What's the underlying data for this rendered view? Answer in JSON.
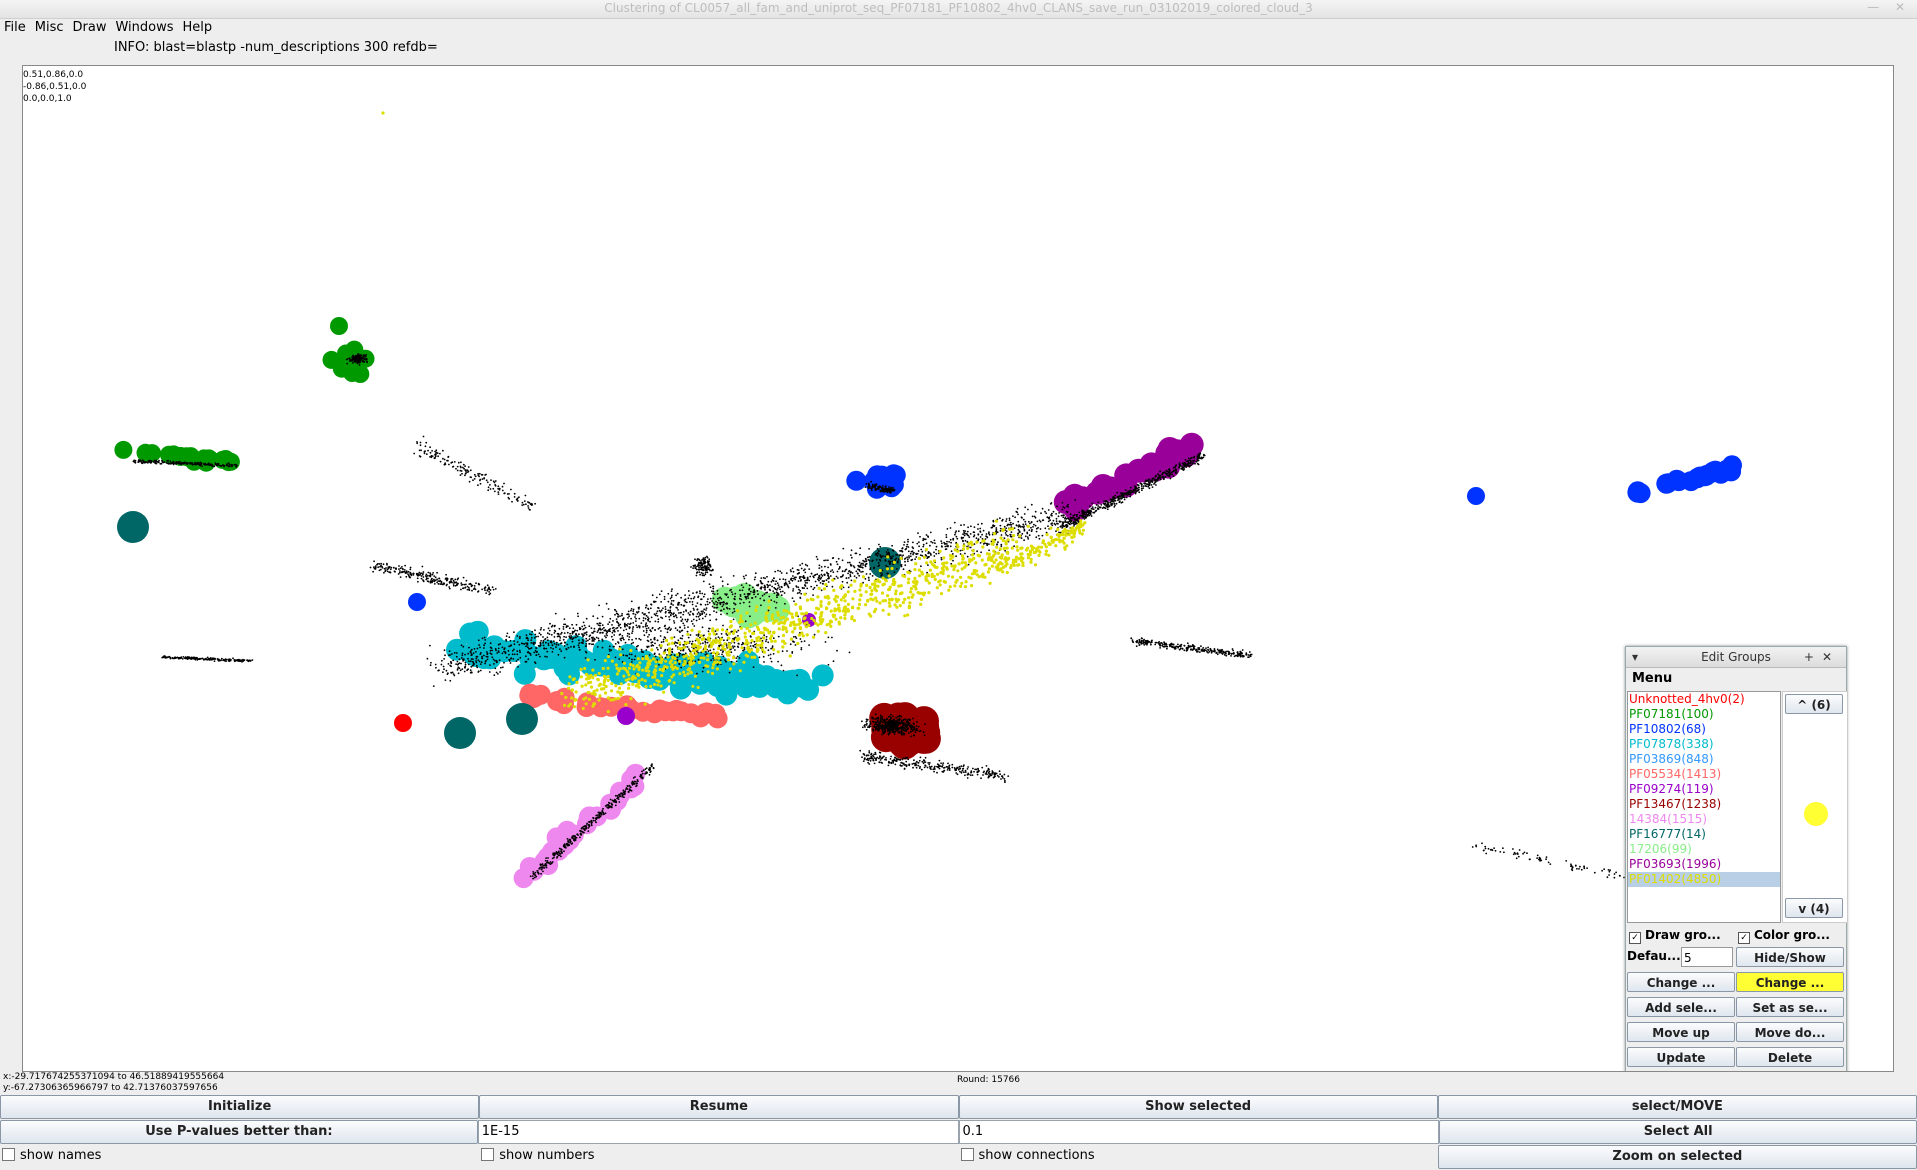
{
  "window": {
    "title": "Clustering of CL0057_all_fam_and_uniprot_seq_PF07181_PF10802_4hv0_CLANS_save_run_03102019_colored_cloud_3"
  },
  "menu": [
    "File",
    "Misc",
    "Draw",
    "Windows",
    "Help"
  ],
  "info_text": "INFO: blast=blastp -num_descriptions 300 refdb=",
  "rotation_matrix": [
    "0.51,0.86,0.0",
    "-0.86,0.51,0.0",
    "0.0,0.0,1.0"
  ],
  "coords": {
    "x_range": "x:-29.717674255371094 to 46.51889419555664",
    "y_range": "y:-67.27306365966797 to 42.71376037597656"
  },
  "round_text": "Round: 15766",
  "controls": {
    "row1": [
      "Initialize",
      "Resume",
      "Show selected",
      "select/MOVE"
    ],
    "pvalue_label": "Use P-values better than:",
    "pvalue_value": "1E-15",
    "second_value": "0.1",
    "select_all": "Select All",
    "show_names": "show names",
    "show_numbers": "show numbers",
    "show_connections": "show connections",
    "zoom_selected": "Zoom on selected"
  },
  "edit_groups": {
    "title": "Edit Groups",
    "menu_label": "Menu",
    "groups": [
      {
        "label": "Unknotted_4hv0(2)",
        "color": "#ff0000"
      },
      {
        "label": "PF07181(100)",
        "color": "#009900"
      },
      {
        "label": "PF10802(68)",
        "color": "#0033ff"
      },
      {
        "label": "PF07878(338)",
        "color": "#00bbcc"
      },
      {
        "label": "PF03869(848)",
        "color": "#3399ff"
      },
      {
        "label": "PF05534(1413)",
        "color": "#ff6666"
      },
      {
        "label": "PF09274(119)",
        "color": "#9900cc"
      },
      {
        "label": "PF13467(1238)",
        "color": "#990000"
      },
      {
        "label": "14384(1515)",
        "color": "#ee88ee"
      },
      {
        "label": "PF16777(14)",
        "color": "#006666"
      },
      {
        "label": "17206(99)",
        "color": "#88ee88"
      },
      {
        "label": "PF03693(1996)",
        "color": "#990099"
      },
      {
        "label": "PF01402(4850)",
        "color": "#dddd00"
      }
    ],
    "up_btn": "^ (6)",
    "down_btn": "v (4)",
    "draw_groups": "Draw gro...",
    "color_groups": "Color gro...",
    "default_label": "Defau...",
    "default_value": "5",
    "buttons": [
      "Hide/Show",
      "Change ...",
      "Change ...",
      "Add sele...",
      "Set as se...",
      "Move up",
      "Move do...",
      "Update",
      "Delete"
    ],
    "selected_color": "#ffff33"
  }
}
